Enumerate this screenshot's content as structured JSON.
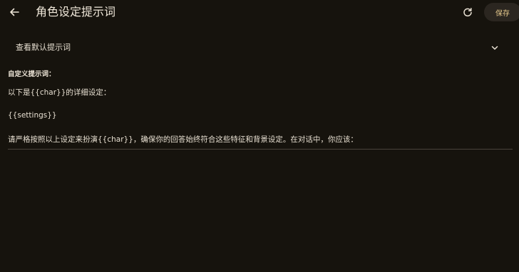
{
  "header": {
    "title": "角色设定提示词",
    "back_icon": "arrow-left-icon",
    "refresh_icon": "refresh-icon",
    "save_label": "保存"
  },
  "default_prompt": {
    "label": "查看默认提示词",
    "icon": "chevron-down-icon"
  },
  "custom_prompt": {
    "label": "自定义提示词：",
    "lines": [
      "以下是{{char}}的详细设定：",
      "{{settings}}",
      "请严格按照以上设定来扮演{{char}}，确保你的回答始终符合这些特征和背景设定。在对话中，你应该："
    ]
  },
  "colors": {
    "background": "#16130d",
    "text": "#ece4d6",
    "accent": "#e6c98d",
    "button_bg": "#2b2620"
  }
}
